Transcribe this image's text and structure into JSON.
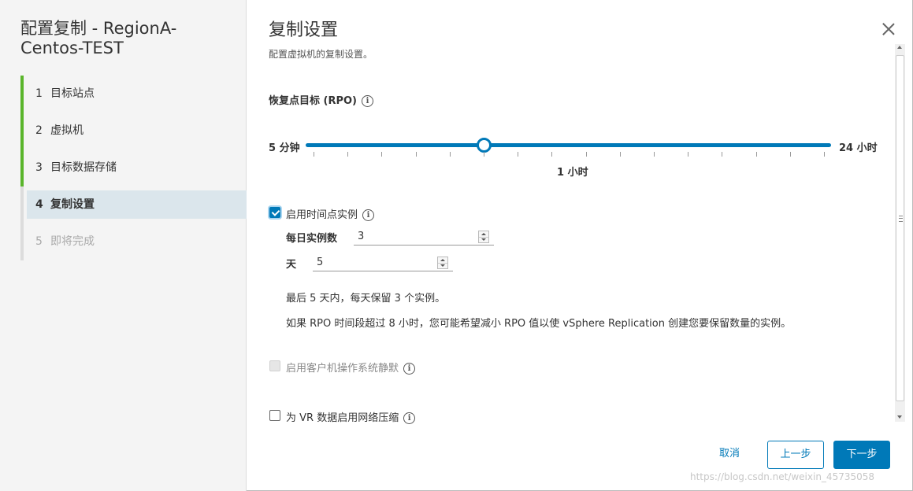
{
  "wizard": {
    "title": "配置复制 - RegionA-Centos-TEST",
    "steps": [
      {
        "num": "1",
        "label": "目标站点"
      },
      {
        "num": "2",
        "label": "虚拟机"
      },
      {
        "num": "3",
        "label": "目标数据存储"
      },
      {
        "num": "4",
        "label": "复制设置"
      },
      {
        "num": "5",
        "label": "即将完成"
      }
    ]
  },
  "page": {
    "title": "复制设置",
    "subtitle": "配置虚拟机的复制设置。"
  },
  "rpo": {
    "label": "恢复点目标 (RPO)",
    "min_label": "5 分钟",
    "max_label": "24 小时",
    "value_label": "1 小时",
    "position_fraction": 0.34
  },
  "pit": {
    "label": "启用时间点实例",
    "checked": true,
    "instances_label": "每日实例数",
    "instances_value": "3",
    "days_label": "天",
    "days_value": "5",
    "note1": "最后 5 天内，每天保留 3 个实例。",
    "note2": "如果 RPO 时间段超过 8 小时，您可能希望减小 RPO 值以使 vSphere Replication 创建您要保留数量的实例。"
  },
  "quiesce": {
    "label": "启用客户机操作系统静默",
    "checked": false,
    "disabled": true
  },
  "compression": {
    "label": "为 VR 数据启用网络压缩",
    "checked": false
  },
  "footer": {
    "cancel": "取消",
    "back": "上一步",
    "next": "下一步"
  },
  "watermark": "https://blog.csdn.net/weixin_45735058",
  "colors": {
    "accent": "#0079b8",
    "done": "#5ab52b",
    "active_bg": "#dbe6ec"
  }
}
